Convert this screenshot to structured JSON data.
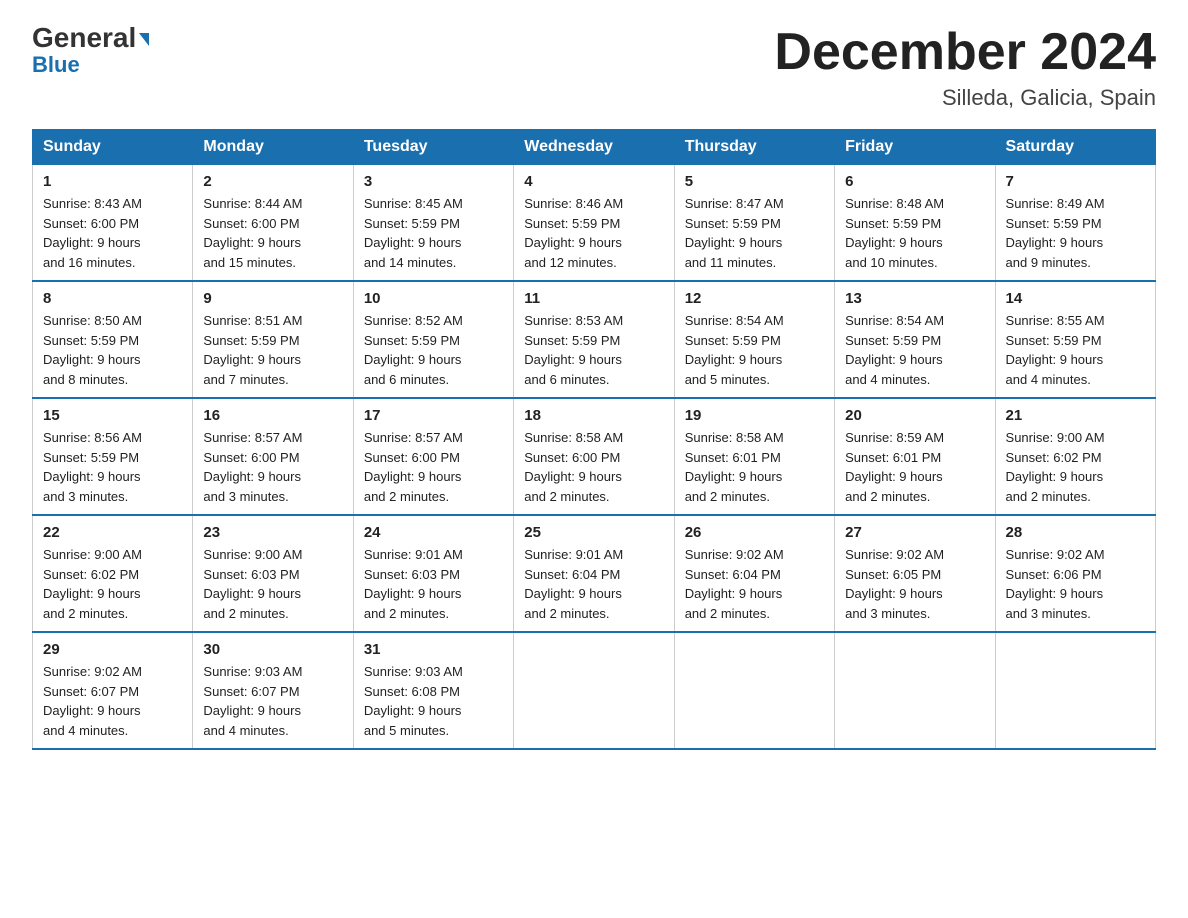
{
  "header": {
    "logo_general": "General",
    "logo_blue": "Blue",
    "title": "December 2024",
    "subtitle": "Silleda, Galicia, Spain"
  },
  "days_of_week": [
    "Sunday",
    "Monday",
    "Tuesday",
    "Wednesday",
    "Thursday",
    "Friday",
    "Saturday"
  ],
  "weeks": [
    [
      {
        "day": "1",
        "sunrise": "8:43 AM",
        "sunset": "6:00 PM",
        "daylight": "9 hours and 16 minutes."
      },
      {
        "day": "2",
        "sunrise": "8:44 AM",
        "sunset": "6:00 PM",
        "daylight": "9 hours and 15 minutes."
      },
      {
        "day": "3",
        "sunrise": "8:45 AM",
        "sunset": "5:59 PM",
        "daylight": "9 hours and 14 minutes."
      },
      {
        "day": "4",
        "sunrise": "8:46 AM",
        "sunset": "5:59 PM",
        "daylight": "9 hours and 12 minutes."
      },
      {
        "day": "5",
        "sunrise": "8:47 AM",
        "sunset": "5:59 PM",
        "daylight": "9 hours and 11 minutes."
      },
      {
        "day": "6",
        "sunrise": "8:48 AM",
        "sunset": "5:59 PM",
        "daylight": "9 hours and 10 minutes."
      },
      {
        "day": "7",
        "sunrise": "8:49 AM",
        "sunset": "5:59 PM",
        "daylight": "9 hours and 9 minutes."
      }
    ],
    [
      {
        "day": "8",
        "sunrise": "8:50 AM",
        "sunset": "5:59 PM",
        "daylight": "9 hours and 8 minutes."
      },
      {
        "day": "9",
        "sunrise": "8:51 AM",
        "sunset": "5:59 PM",
        "daylight": "9 hours and 7 minutes."
      },
      {
        "day": "10",
        "sunrise": "8:52 AM",
        "sunset": "5:59 PM",
        "daylight": "9 hours and 6 minutes."
      },
      {
        "day": "11",
        "sunrise": "8:53 AM",
        "sunset": "5:59 PM",
        "daylight": "9 hours and 6 minutes."
      },
      {
        "day": "12",
        "sunrise": "8:54 AM",
        "sunset": "5:59 PM",
        "daylight": "9 hours and 5 minutes."
      },
      {
        "day": "13",
        "sunrise": "8:54 AM",
        "sunset": "5:59 PM",
        "daylight": "9 hours and 4 minutes."
      },
      {
        "day": "14",
        "sunrise": "8:55 AM",
        "sunset": "5:59 PM",
        "daylight": "9 hours and 4 minutes."
      }
    ],
    [
      {
        "day": "15",
        "sunrise": "8:56 AM",
        "sunset": "5:59 PM",
        "daylight": "9 hours and 3 minutes."
      },
      {
        "day": "16",
        "sunrise": "8:57 AM",
        "sunset": "6:00 PM",
        "daylight": "9 hours and 3 minutes."
      },
      {
        "day": "17",
        "sunrise": "8:57 AM",
        "sunset": "6:00 PM",
        "daylight": "9 hours and 2 minutes."
      },
      {
        "day": "18",
        "sunrise": "8:58 AM",
        "sunset": "6:00 PM",
        "daylight": "9 hours and 2 minutes."
      },
      {
        "day": "19",
        "sunrise": "8:58 AM",
        "sunset": "6:01 PM",
        "daylight": "9 hours and 2 minutes."
      },
      {
        "day": "20",
        "sunrise": "8:59 AM",
        "sunset": "6:01 PM",
        "daylight": "9 hours and 2 minutes."
      },
      {
        "day": "21",
        "sunrise": "9:00 AM",
        "sunset": "6:02 PM",
        "daylight": "9 hours and 2 minutes."
      }
    ],
    [
      {
        "day": "22",
        "sunrise": "9:00 AM",
        "sunset": "6:02 PM",
        "daylight": "9 hours and 2 minutes."
      },
      {
        "day": "23",
        "sunrise": "9:00 AM",
        "sunset": "6:03 PM",
        "daylight": "9 hours and 2 minutes."
      },
      {
        "day": "24",
        "sunrise": "9:01 AM",
        "sunset": "6:03 PM",
        "daylight": "9 hours and 2 minutes."
      },
      {
        "day": "25",
        "sunrise": "9:01 AM",
        "sunset": "6:04 PM",
        "daylight": "9 hours and 2 minutes."
      },
      {
        "day": "26",
        "sunrise": "9:02 AM",
        "sunset": "6:04 PM",
        "daylight": "9 hours and 2 minutes."
      },
      {
        "day": "27",
        "sunrise": "9:02 AM",
        "sunset": "6:05 PM",
        "daylight": "9 hours and 3 minutes."
      },
      {
        "day": "28",
        "sunrise": "9:02 AM",
        "sunset": "6:06 PM",
        "daylight": "9 hours and 3 minutes."
      }
    ],
    [
      {
        "day": "29",
        "sunrise": "9:02 AM",
        "sunset": "6:07 PM",
        "daylight": "9 hours and 4 minutes."
      },
      {
        "day": "30",
        "sunrise": "9:03 AM",
        "sunset": "6:07 PM",
        "daylight": "9 hours and 4 minutes."
      },
      {
        "day": "31",
        "sunrise": "9:03 AM",
        "sunset": "6:08 PM",
        "daylight": "9 hours and 5 minutes."
      },
      null,
      null,
      null,
      null
    ]
  ],
  "labels": {
    "sunrise": "Sunrise:",
    "sunset": "Sunset:",
    "daylight": "Daylight:"
  }
}
